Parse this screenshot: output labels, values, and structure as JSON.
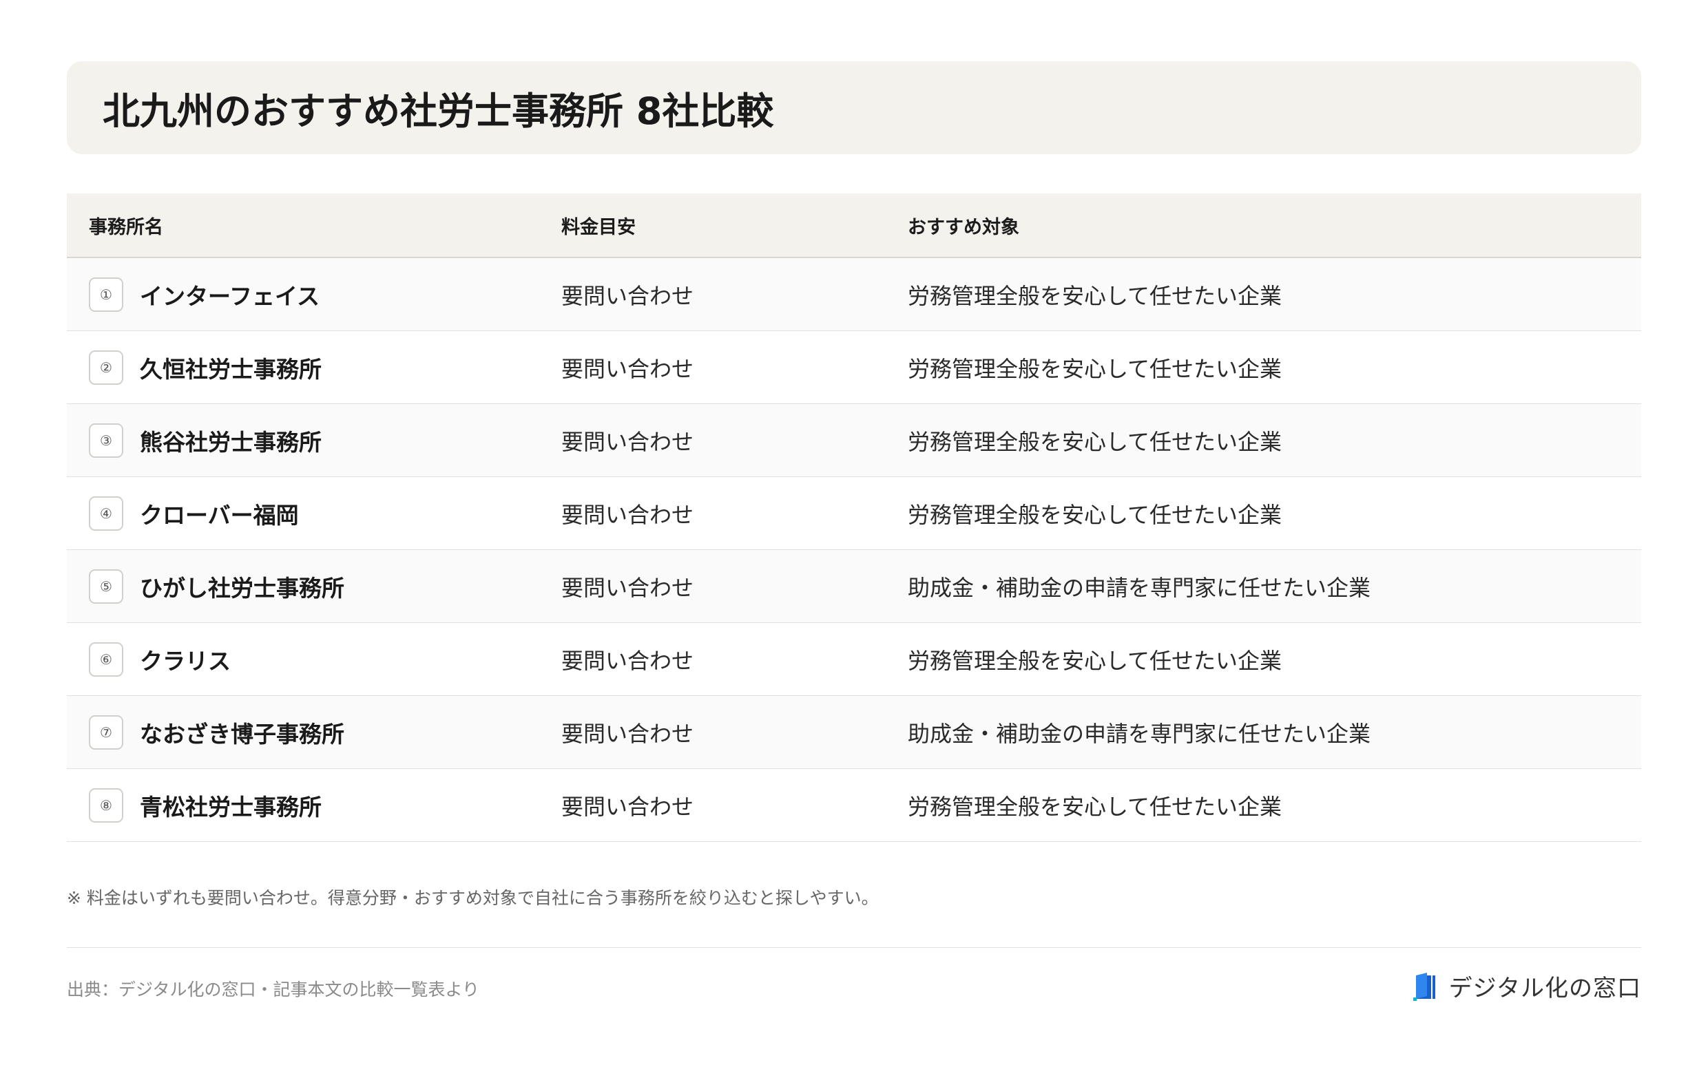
{
  "title": "北九州のおすすめ社労士事務所 8社比較",
  "table": {
    "headers": {
      "name": "事務所名",
      "fee": "料金目安",
      "target": "おすすめ対象"
    },
    "rows": [
      {
        "num": "①",
        "name": "インターフェイス",
        "fee": "要問い合わせ",
        "target": "労務管理全般を安心して任せたい企業"
      },
      {
        "num": "②",
        "name": "久恒社労士事務所",
        "fee": "要問い合わせ",
        "target": "労務管理全般を安心して任せたい企業"
      },
      {
        "num": "③",
        "name": "熊谷社労士事務所",
        "fee": "要問い合わせ",
        "target": "労務管理全般を安心して任せたい企業"
      },
      {
        "num": "④",
        "name": "クローバー福岡",
        "fee": "要問い合わせ",
        "target": "労務管理全般を安心して任せたい企業"
      },
      {
        "num": "⑤",
        "name": "ひがし社労士事務所",
        "fee": "要問い合わせ",
        "target": "助成金・補助金の申請を専門家に任せたい企業"
      },
      {
        "num": "⑥",
        "name": "クラリス",
        "fee": "要問い合わせ",
        "target": "労務管理全般を安心して任せたい企業"
      },
      {
        "num": "⑦",
        "name": "なおざき博子事務所",
        "fee": "要問い合わせ",
        "target": "助成金・補助金の申請を専門家に任せたい企業"
      },
      {
        "num": "⑧",
        "name": "青松社労士事務所",
        "fee": "要問い合わせ",
        "target": "労務管理全般を安心して任せたい企業"
      }
    ]
  },
  "note": "※ 料金はいずれも要問い合わせ。得意分野・おすすめ対象で自社に合う事務所を絞り込むと探しやすい。",
  "footer": {
    "source": "出典：デジタル化の窓口・記事本文の比較一覧表より",
    "logo_text": "デジタル化の窓口",
    "logo_icon": "door-logo-icon"
  },
  "colors": {
    "title_bg": "#f4f2ec",
    "logo_blue": "#1a5fd0"
  }
}
